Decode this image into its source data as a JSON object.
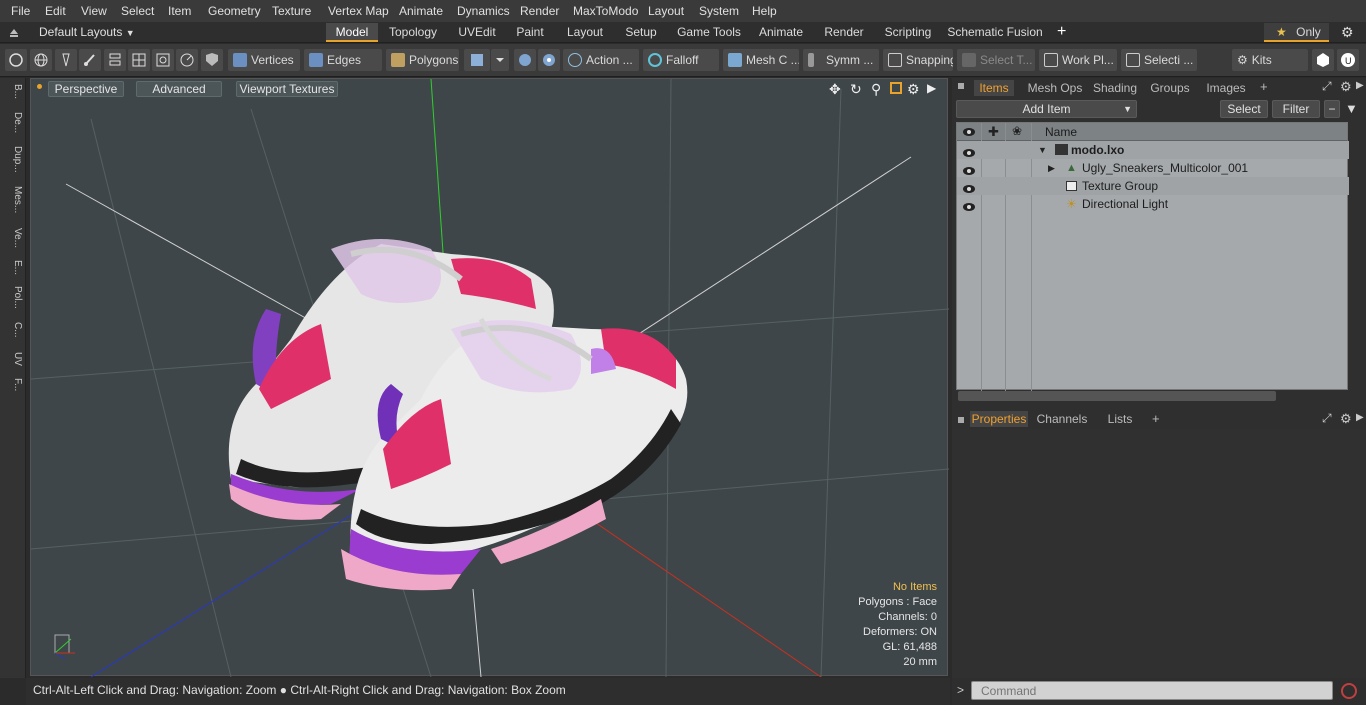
{
  "menu": [
    "File",
    "Edit",
    "View",
    "Select",
    "Item",
    "Geometry",
    "Texture",
    "Vertex Map",
    "Animate",
    "Dynamics",
    "Render",
    "MaxToModo",
    "Layout",
    "System",
    "Help"
  ],
  "layout_bar": {
    "layout_label": "Default Layouts",
    "tabs": [
      "Model",
      "Topology",
      "UVEdit",
      "Paint",
      "Layout",
      "Setup",
      "Game Tools",
      "Animate",
      "Render",
      "Scripting",
      "Schematic Fusion"
    ],
    "active_tab": "Model",
    "only_label": "Only"
  },
  "toolbar": {
    "vertices": "Vertices",
    "edges": "Edges",
    "polygons": "Polygons",
    "action": "Action ...",
    "falloff": "Falloff",
    "mesh": "Mesh C ...",
    "symmetry": "Symm ...",
    "snapping": "Snapping",
    "select_t": "Select T...",
    "work_plane": "Work Pl...",
    "selection": "Selecti ...",
    "kits": "Kits"
  },
  "left_strip": [
    "B...",
    "De...",
    "Dup...",
    "Mes...",
    "Ve...",
    "E...",
    "Pol...",
    "C...",
    "UV",
    "F..."
  ],
  "viewport": {
    "view_mode": "Perspective",
    "shading": "Advanced",
    "textures": "Viewport Textures",
    "info": {
      "items": "No Items",
      "polygons": "Polygons : Face",
      "channels": "Channels: 0",
      "deformers": "Deformers: ON",
      "gl": "GL: 61,488",
      "scale": "20 mm"
    }
  },
  "status": {
    "text": "Ctrl-Alt-Left Click and Drag: Navigation: Zoom ● Ctrl-Alt-Right Click and Drag: Navigation: Box Zoom"
  },
  "items_panel": {
    "tabs": [
      "Items",
      "Mesh Ops",
      "Shading",
      "Groups",
      "Images"
    ],
    "active_tab": "Items",
    "add_item": "Add Item",
    "select": "Select",
    "filter": "Filter",
    "name_header": "Name",
    "rows": [
      {
        "label": "modo.lxo",
        "indent": 0,
        "bold": true
      },
      {
        "label": "Ugly_Sneakers_Multicolor_001",
        "indent": 1,
        "bold": false
      },
      {
        "label": "Texture Group",
        "indent": 1,
        "bold": false
      },
      {
        "label": "Directional Light",
        "indent": 1,
        "bold": false
      }
    ]
  },
  "properties_panel": {
    "tabs": [
      "Properties",
      "Channels",
      "Lists"
    ],
    "active_tab": "Properties"
  },
  "command": {
    "placeholder": "Command"
  },
  "colors": {
    "accent": "#e8a32b",
    "viewport_bg": "#3e4649",
    "list_bg": "#a5a9ac"
  }
}
